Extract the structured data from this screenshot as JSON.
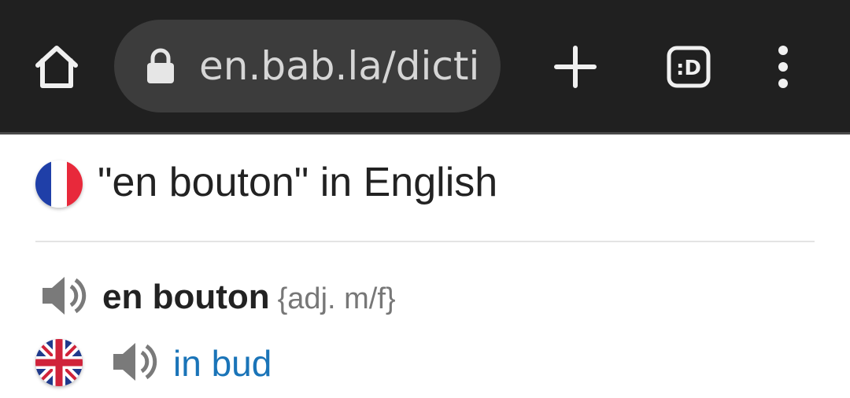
{
  "browser": {
    "url_display": "en.bab.la/dictionary/french-english/en-bouton",
    "extension_badge": ":D",
    "icons": [
      "home-icon",
      "lock-icon",
      "plus-icon",
      "extension-icon",
      "more-vert-icon"
    ],
    "toolbar_color": "#202020",
    "omnibox_color": "#3c3c3c"
  },
  "page": {
    "heading": "\"en bouton\" in English",
    "source_flag": "flag-france-icon",
    "entry": {
      "term": "en bouton",
      "pos": "{adj. m/f}",
      "audio_icon": "speaker-icon"
    },
    "translation": {
      "flag": "flag-uk-icon",
      "audio_icon": "speaker-icon",
      "text": "in bud",
      "link_color": "#1a74b8"
    }
  }
}
